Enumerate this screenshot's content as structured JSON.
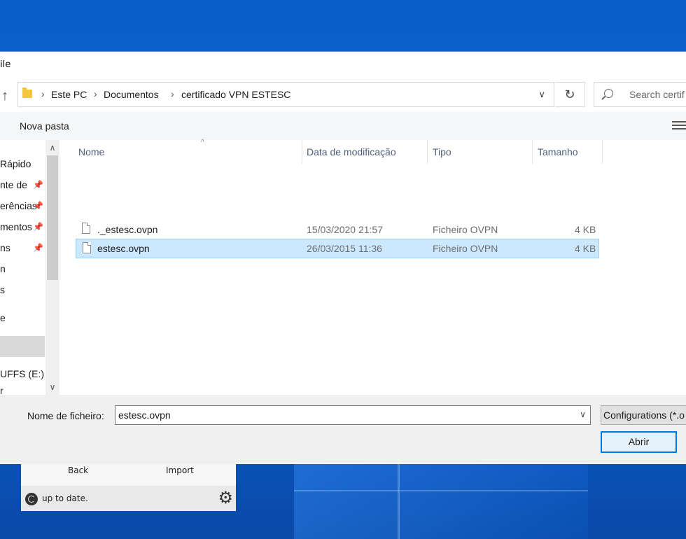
{
  "background_app": {
    "back_label": "Back",
    "import_label": "Import",
    "status_text": "up to date.",
    "refresh_icon": "refresh-icon",
    "gear_icon": "gear-icon"
  },
  "dialog": {
    "title": "ile",
    "up_icon": "up-arrow-icon",
    "breadcrumb": [
      "Este PC",
      "Documentos",
      "certificado VPN ESTESC"
    ],
    "search_placeholder": "Search certif",
    "new_folder_label": "Nova pasta",
    "nav_items": [
      {
        "label": "Rápido",
        "pinned": false
      },
      {
        "label": "nte de",
        "pinned": true
      },
      {
        "label": "erências",
        "pinned": true
      },
      {
        "label": "mentos",
        "pinned": true
      },
      {
        "label": "ns",
        "pinned": true
      },
      {
        "label": "n",
        "pinned": false
      },
      {
        "label": "s",
        "pinned": false
      },
      {
        "label": "",
        "pinned": false
      },
      {
        "label": "e",
        "pinned": false
      },
      {
        "label": "",
        "pinned": false,
        "selected": true
      },
      {
        "label": "UFFS (E:)",
        "pinned": false
      },
      {
        "label": "r",
        "pinned": false
      }
    ],
    "columns": [
      "Nome",
      "Data de modificação",
      "Tipo",
      "Tamanho"
    ],
    "files": [
      {
        "name": "._estesc.ovpn",
        "modified": "15/03/2020 21:57",
        "type": "Ficheiro OVPN",
        "size": "4 KB",
        "selected": false
      },
      {
        "name": "estesc.ovpn",
        "modified": "26/03/2015 11:36",
        "type": "Ficheiro OVPN",
        "size": "4 KB",
        "selected": true
      }
    ],
    "filename_label": "Nome de ficheiro:",
    "filename_value": "estesc.ovpn",
    "filter_value": "Configurations (*.o",
    "open_button": "Abrir"
  },
  "colors": {
    "desktop": "#0b63d2",
    "selection": "#cce8ff",
    "accent": "#0078d7"
  }
}
